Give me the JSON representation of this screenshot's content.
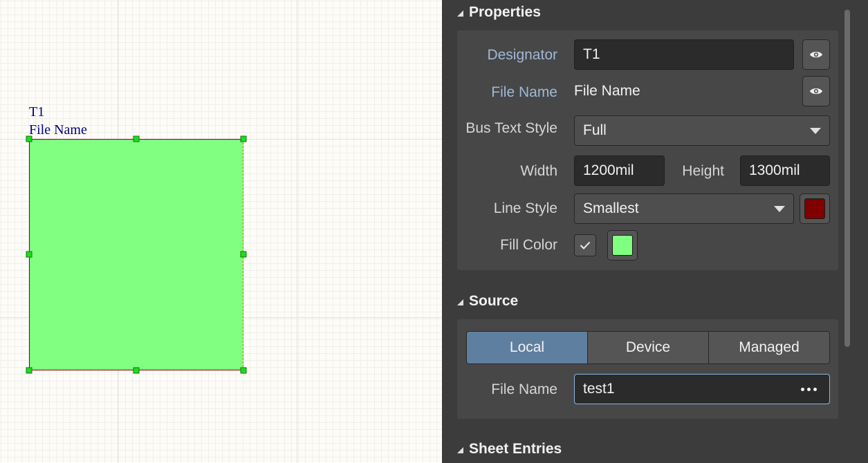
{
  "canvas": {
    "designator_label": "T1",
    "filename_label": "File Name",
    "sheet_fill": "#80ff80",
    "sheet_line": "#8b0000"
  },
  "properties": {
    "title": "Properties",
    "designator": {
      "label": "Designator",
      "value": "T1",
      "icon": "eye-icon"
    },
    "file_name": {
      "label": "File Name",
      "value": "File Name",
      "icon": "eye-icon"
    },
    "bus_text_style": {
      "label": "Bus Text Style",
      "value": "Full"
    },
    "width": {
      "label": "Width",
      "value": "1200mil"
    },
    "height": {
      "label": "Height",
      "value": "1300mil"
    },
    "line_style": {
      "label": "Line Style",
      "value": "Smallest",
      "color": "#800000"
    },
    "fill_color": {
      "label": "Fill Color",
      "checked": true,
      "color": "#80ff80"
    }
  },
  "source": {
    "title": "Source",
    "tabs": [
      {
        "label": "Local",
        "active": true
      },
      {
        "label": "Device",
        "active": false
      },
      {
        "label": "Managed",
        "active": false
      }
    ],
    "file_name": {
      "label": "File Name",
      "value": "test1"
    }
  },
  "sheet_entries": {
    "title": "Sheet Entries"
  }
}
